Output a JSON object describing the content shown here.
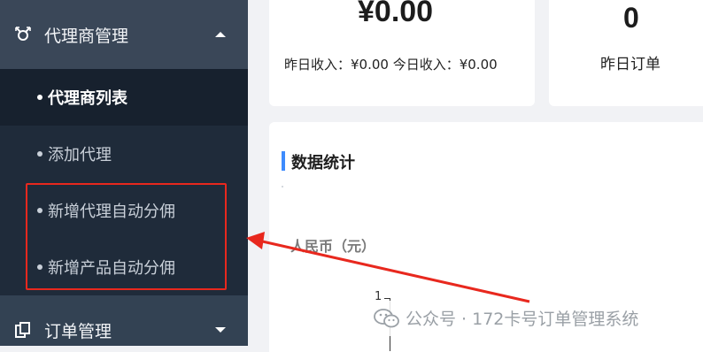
{
  "sidebar": {
    "agent_group": {
      "label": "代理商管理",
      "icon": "users-icon",
      "caret": "caret-up-icon"
    },
    "sub_items": [
      {
        "label": "代理商列表",
        "active": true
      },
      {
        "label": "添加代理",
        "active": false
      },
      {
        "label": "新增代理自动分佣",
        "active": false
      },
      {
        "label": "新增产品自动分佣",
        "active": false
      }
    ],
    "order_group": {
      "label": "订单管理",
      "icon": "order-icon",
      "caret": "caret-down-icon"
    }
  },
  "cards": {
    "revenue": {
      "value": "¥0.00",
      "detail": "昨日收入：¥0.00 今日收入：¥0.00"
    },
    "orders": {
      "value": "0",
      "label": "昨日订单"
    }
  },
  "stats": {
    "heading": "数据统计",
    "chart": {
      "ylabel": "人民币（元）",
      "tick": "1"
    }
  },
  "watermark": {
    "text": "公众号 · 172卡号订单管理系统"
  },
  "colors": {
    "sidebar_bg": "#2f3c4d",
    "submenu_bg": "#1f2b3a",
    "highlight_red": "#e8281e",
    "accent_blue": "#3d8bfd"
  }
}
